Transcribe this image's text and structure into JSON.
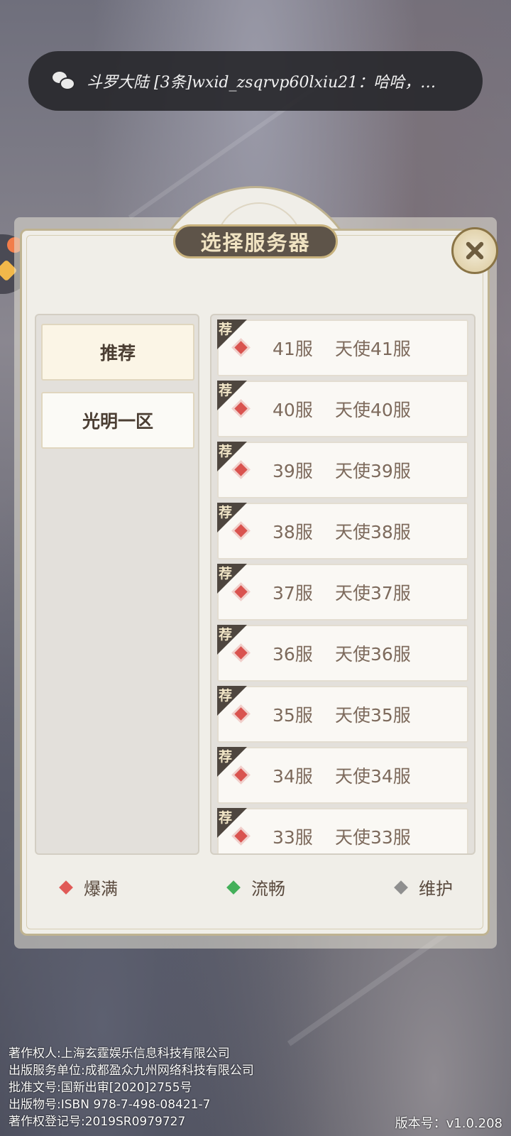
{
  "notification": {
    "app_icon": "wechat-icon",
    "text": "斗罗大陆 [3条]wxid_zsqrvp60lxiu21：哈哈，…"
  },
  "dialog": {
    "title": "选择服务器",
    "close_icon": "close-icon"
  },
  "zones": [
    {
      "label": "推荐",
      "selected": true
    },
    {
      "label": "光明一区",
      "selected": false
    }
  ],
  "servers": [
    {
      "tag": "荐",
      "status": "爆满",
      "number": "41服",
      "name": "天使41服"
    },
    {
      "tag": "荐",
      "status": "爆满",
      "number": "40服",
      "name": "天使40服"
    },
    {
      "tag": "荐",
      "status": "爆满",
      "number": "39服",
      "name": "天使39服"
    },
    {
      "tag": "荐",
      "status": "爆满",
      "number": "38服",
      "name": "天使38服"
    },
    {
      "tag": "荐",
      "status": "爆满",
      "number": "37服",
      "name": "天使37服"
    },
    {
      "tag": "荐",
      "status": "爆满",
      "number": "36服",
      "name": "天使36服"
    },
    {
      "tag": "荐",
      "status": "爆满",
      "number": "35服",
      "name": "天使35服"
    },
    {
      "tag": "荐",
      "status": "爆满",
      "number": "34服",
      "name": "天使34服"
    },
    {
      "tag": "荐",
      "status": "爆满",
      "number": "33服",
      "name": "天使33服"
    }
  ],
  "legend": [
    {
      "label": "爆满",
      "color": "#e05a57"
    },
    {
      "label": "流畅",
      "color": "#44b05a"
    },
    {
      "label": "维护",
      "color": "#8f8f8f"
    }
  ],
  "footer": {
    "lines": [
      "著作权人:上海玄霆娱乐信息科技有限公司",
      "出版服务单位:成都盈众九州网络科技有限公司",
      "批准文号:国新出审[2020]2755号",
      "出版物号:ISBN 978-7-498-08421-7",
      "著作权登记号:2019SR0979727"
    ],
    "version": "版本号：v1.0.208"
  }
}
